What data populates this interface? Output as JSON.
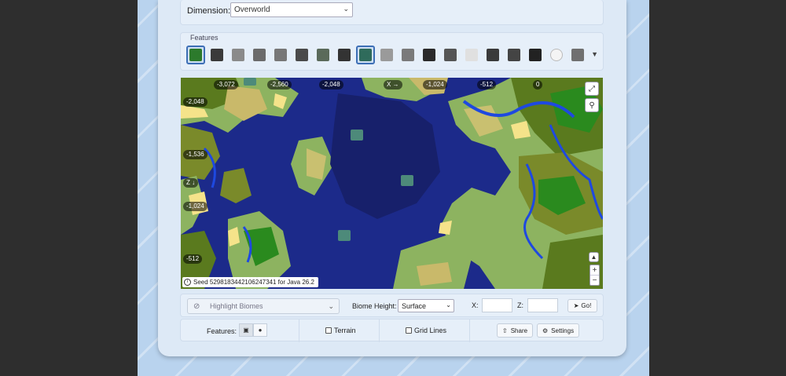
{
  "dimension": {
    "label": "Dimension:",
    "value": "Overworld"
  },
  "features": {
    "title": "Features",
    "icons": [
      {
        "name": "biome-map-icon",
        "color": "#2c7a2c"
      },
      {
        "name": "cauldron-icon",
        "color": "#3a3a3a"
      },
      {
        "name": "stone-block-icon",
        "color": "#8a8a8a"
      },
      {
        "name": "dispenser-icon",
        "color": "#6b6b6b"
      },
      {
        "name": "potion-icon",
        "color": "#777777"
      },
      {
        "name": "iron-bars-icon",
        "color": "#4a4a4a"
      },
      {
        "name": "end-portal-eye-icon",
        "color": "#5a6a5a"
      },
      {
        "name": "witch-hut-icon",
        "color": "#333333"
      },
      {
        "name": "ocean-ruin-icon",
        "color": "#2f6b5b"
      },
      {
        "name": "skull-icon",
        "color": "#9a9a9a"
      },
      {
        "name": "ladder-icon",
        "color": "#7a7a7a"
      },
      {
        "name": "obsidian-icon",
        "color": "#2a2a2a"
      },
      {
        "name": "cobblestone-icon",
        "color": "#555555"
      },
      {
        "name": "snow-block-icon",
        "color": "#e0e0e0"
      },
      {
        "name": "pillager-outpost-icon",
        "color": "#3a3a3a"
      },
      {
        "name": "chest-icon",
        "color": "#444444"
      },
      {
        "name": "anchor-icon",
        "color": "#222222"
      },
      {
        "name": "snowball-icon",
        "color": "#f4f4f4"
      },
      {
        "name": "trial-chamber-icon",
        "color": "#707070"
      }
    ],
    "more_icon": "chevron-down-icon"
  },
  "map": {
    "x_ticks": [
      "-3,072",
      "-2,560",
      "-2,048",
      "X →",
      "-1,024",
      "-512",
      "0"
    ],
    "z_ticks": [
      "-2,048",
      "-1,536",
      "Z ↓",
      "-1,024",
      "-512"
    ],
    "seed_text": "Seed 5298183442106247341 for Java 26.2",
    "colors": {
      "deep_ocean": "#1c2a8a",
      "ocean": "#2233b8",
      "shallow": "#1e49e0",
      "plains": "#8db360",
      "forest": "#5a7a1e",
      "jungle": "#2a8a1e",
      "beach": "#f5e38a",
      "swamp": "#5a7a3a"
    }
  },
  "controls": {
    "highlight_biomes": "Highlight Biomes",
    "biome_height_label": "Biome Height:",
    "biome_height_value": "Surface",
    "x_label": "X:",
    "z_label": "Z:",
    "go_label": "Go!",
    "features_label": "Features:",
    "terrain_label": "Terrain",
    "grid_lines_label": "Grid Lines",
    "share_label": "Share",
    "settings_label": "Settings"
  }
}
